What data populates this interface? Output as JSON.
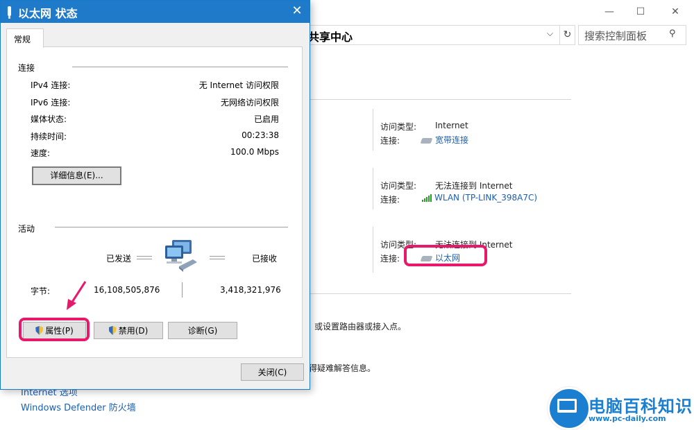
{
  "background_window": {
    "address_text": "共享中心",
    "search_placeholder": "搜索控制面板",
    "networks": [
      {
        "type_label": "访问类型:",
        "type_value": "Internet",
        "conn_label": "连接:",
        "conn_value": "宽带连接"
      },
      {
        "type_label": "访问类型:",
        "type_value": "无法连接到 Internet",
        "conn_label": "连接:",
        "conn_value": "WLAN (TP-LINK_398A7C)"
      },
      {
        "type_label": "访问类型:",
        "type_value": "无法连接到 Internet",
        "conn_label": "连接:",
        "conn_value": "以太网"
      }
    ],
    "text_router": "或设置路由器或接入点。",
    "text_trouble": "得疑难解答信息。",
    "see_also": [
      "Internet 选项",
      "Windows Defender 防火墙"
    ]
  },
  "dialog": {
    "title": "以太网 状态",
    "tab": "常规",
    "section_connection": "连接",
    "rows": [
      {
        "key": "IPv4 连接:",
        "value": "无 Internet 访问权限"
      },
      {
        "key": "IPv6 连接:",
        "value": "无网络访问权限"
      },
      {
        "key": "媒体状态:",
        "value": "已启用"
      },
      {
        "key": "持续时间:",
        "value": "00:23:38"
      },
      {
        "key": "速度:",
        "value": "100.0 Mbps"
      }
    ],
    "details_button": "详细信息(E)...",
    "section_activity": "活动",
    "sent_label": "已发送",
    "received_label": "已接收",
    "bytes_label": "字节:",
    "bytes_sent": "16,108,505,876",
    "bytes_received": "3,418,321,976",
    "properties_button": "属性(P)",
    "disable_button": "禁用(D)",
    "diagnose_button": "诊断(G)",
    "close_button": "关闭(C)"
  },
  "watermark": {
    "title": "电脑百科知识",
    "url": "www.pc-daily.com"
  },
  "colors": {
    "titlebar": "#1f7ac9",
    "highlight": "#e8196a",
    "link": "#1a5fb4",
    "wifi_bars": "#2b9b2b"
  }
}
